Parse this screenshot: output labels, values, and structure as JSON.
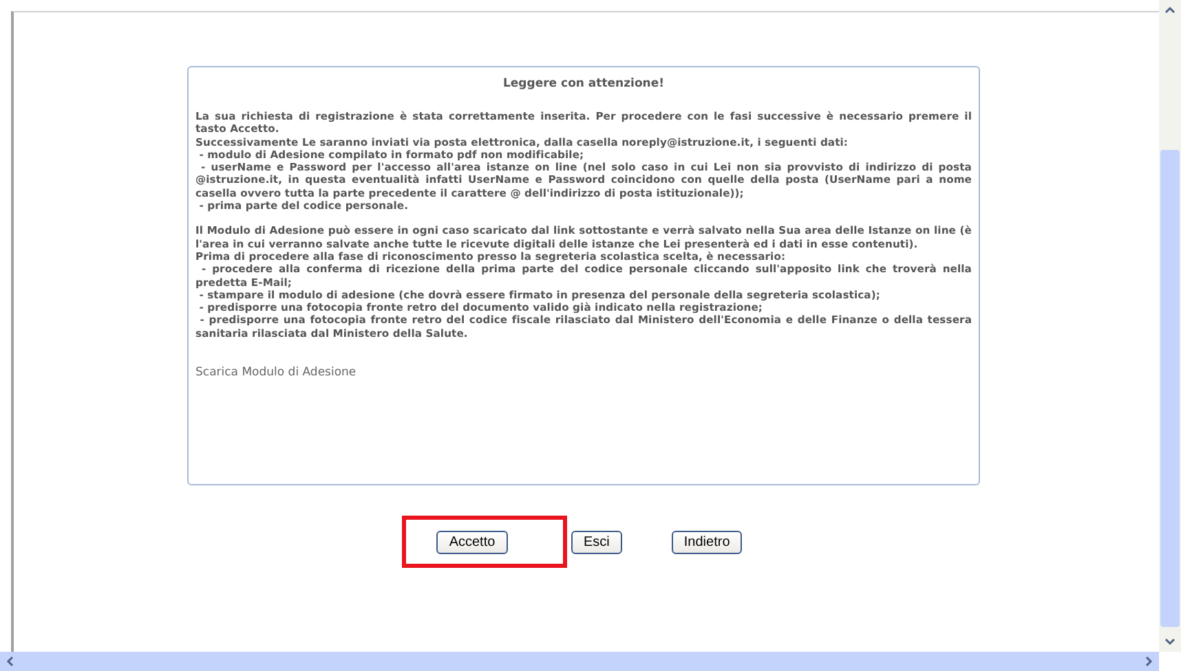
{
  "notice": {
    "title": "Leggere con attenzione!",
    "sections": [
      [
        "La sua richiesta di registrazione è stata correttamente inserita. Per procedere con le fasi successive è necessario premere il tasto Accetto.",
        "Successivamente Le saranno inviati via posta elettronica, dalla casella noreply@istruzione.it, i seguenti dati:",
        " - modulo di Adesione compilato in formato pdf non modificabile;",
        " - userName e Password per l'accesso all'area istanze on line (nel solo caso in cui Lei non sia provvisto di indirizzo di posta @istruzione.it, in questa eventualità infatti UserName e Password coincidono con quelle della posta (UserName pari a nome casella ovvero tutta la parte precedente il carattere @ dell'indirizzo di posta istituzionale));",
        " - prima parte del codice personale."
      ],
      [
        "Il Modulo di Adesione può essere in ogni caso scaricato dal link sottostante e verrà salvato nella Sua area delle Istanze on line (è l'area in cui verranno salvate anche tutte le ricevute digitali delle istanze che Lei presenterà ed i dati in esse contenuti).",
        "Prima di procedere alla fase di riconoscimento presso la segreteria scolastica scelta, è necessario:",
        " - procedere alla conferma di ricezione della prima parte del codice personale cliccando sull'apposito link che troverà nella predetta E-Mail;",
        " - stampare il modulo di adesione (che dovrà essere firmato in presenza del personale della segreteria scolastica);",
        " - predisporre una fotocopia fronte retro del documento valido già indicato nella registrazione;",
        " - predisporre una fotocopia fronte retro del codice fiscale rilasciato dal Ministero dell'Economia e delle Finanze o della tessera sanitaria rilasciata dal Ministero della Salute."
      ]
    ],
    "link": "Scarica Modulo di Adesione"
  },
  "buttons": [
    {
      "label": "Accetto",
      "highlighted": true
    },
    {
      "label": "Esci",
      "highlighted": false
    },
    {
      "label": "Indietro",
      "highlighted": false
    }
  ]
}
